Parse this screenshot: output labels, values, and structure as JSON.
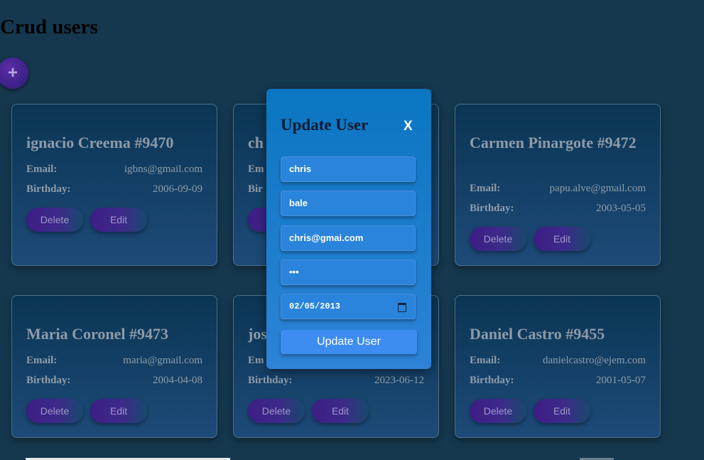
{
  "page": {
    "title": "Crud users",
    "add_label": "+"
  },
  "actions": {
    "delete": "Delete",
    "edit": "Edit"
  },
  "labels": {
    "email": "Email:",
    "birthday": "Birthday:"
  },
  "users": [
    {
      "title": "ignacio Creema #9470",
      "email": "igbns@gmail.com",
      "birthday": "2006-09-09"
    },
    {
      "title": "ch",
      "email": "",
      "birthday": ""
    },
    {
      "title": "Carmen Pinargote #9472",
      "email": "papu.alve@gmail.com",
      "birthday": "2003-05-05"
    },
    {
      "title": "Maria Coronel #9473",
      "email": "maria@gmail.com",
      "birthday": "2004-04-08"
    },
    {
      "title": "jos",
      "email": "",
      "birthday": "2023-06-12"
    },
    {
      "title": "Daniel Castro #9455",
      "email": "danielcastro@ejem.com",
      "birthday": "2001-05-07"
    }
  ],
  "partial_labels": {
    "email": "Em",
    "birthday": "Bir",
    "delete": "D"
  },
  "modal": {
    "title": "Update User",
    "close": "X",
    "first_name": "chris",
    "last_name": "bale",
    "email": "chris@gmai.com",
    "password_mask": "•••",
    "birthday": "02/05/2013",
    "submit": "Update User"
  },
  "colors": {
    "background": "#15384f",
    "modal": "#0a76c2",
    "accent": "#3d1d84"
  },
  "icons": {
    "add": "plus-icon",
    "close": "close-icon",
    "calendar": "calendar-icon"
  }
}
